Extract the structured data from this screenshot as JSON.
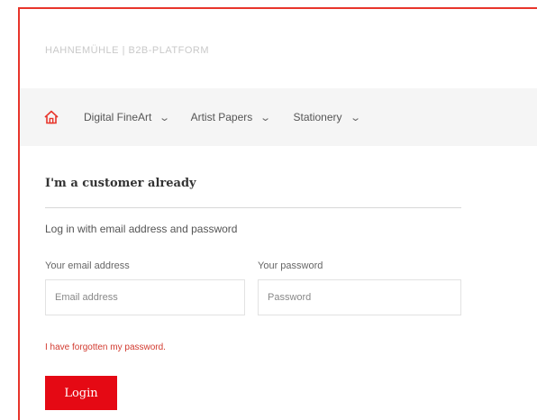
{
  "brand": "HAHNEMÜHLE | B2B-PLATFORM",
  "nav": {
    "home_icon": "home-icon",
    "items": [
      {
        "label": "Digital FineArt"
      },
      {
        "label": "Artist Papers"
      },
      {
        "label": "Stationery"
      }
    ],
    "chevron": "⌄"
  },
  "login": {
    "heading": "I'm a customer already",
    "intro": "Log in with email address and password",
    "email_label": "Your email address",
    "email_placeholder": "Email address",
    "password_label": "Your password",
    "password_placeholder": "Password",
    "forgot_link": "I have forgotten my password.",
    "button_label": "Login"
  },
  "colors": {
    "accent": "#e50914",
    "frame_border": "#e8352b",
    "nav_background": "#f5f5f5"
  }
}
